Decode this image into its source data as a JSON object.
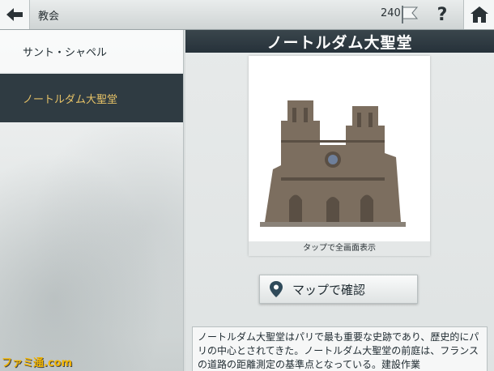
{
  "header": {
    "section_title": "教会",
    "points": "240",
    "help_label": "?"
  },
  "sidebar": {
    "items": [
      {
        "label": "サント・シャペル",
        "selected": false
      },
      {
        "label": "ノートルダム大聖堂",
        "selected": true
      }
    ]
  },
  "main": {
    "title": "ノートルダム大聖堂",
    "image_hint": "タップで全画面表示",
    "map_button_label": "マップで確認",
    "description": "ノートルダム大聖堂はパリで最も重要な史跡であり、歴史的にパリの中心とされてきた。ノートルダム大聖堂の前庭は、フランスの道路の距離測定の基準点となっている。建設作業"
  },
  "watermark": "ファミ通.com",
  "colors": {
    "title_bar": "#2f3b42",
    "selected_item_bg": "#2f3b42",
    "selected_item_text": "#e6c267"
  },
  "icons": [
    "back-arrow-icon",
    "flag-icon",
    "help-icon",
    "home-icon",
    "map-pin-icon"
  ]
}
